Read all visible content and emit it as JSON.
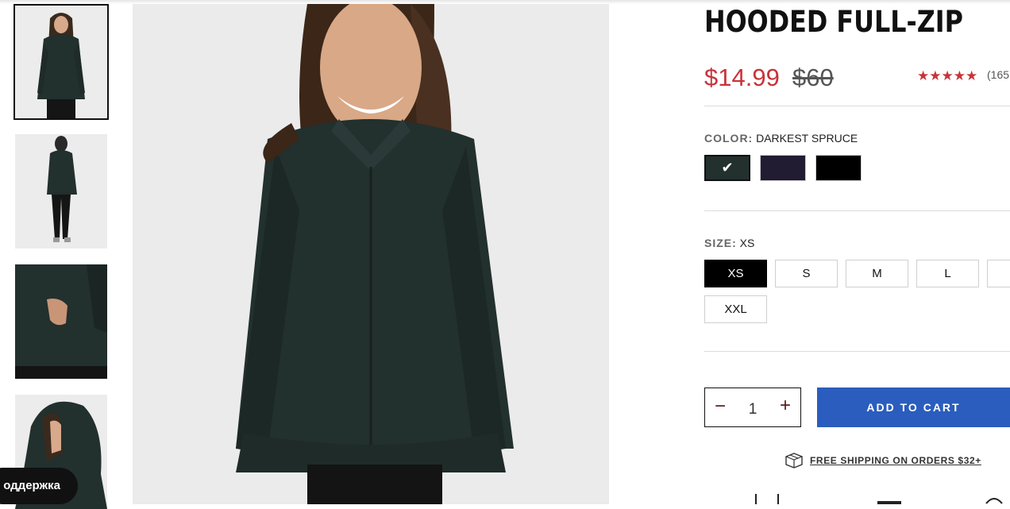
{
  "product": {
    "title": "HOODED FULL-ZIP",
    "price": "$14.99",
    "old_price": "$60",
    "rating_stars": "★★★★★",
    "rating_value": 5,
    "reviews": "(165"
  },
  "color": {
    "label": "COLOR:",
    "selected": "DARKEST SPRUCE",
    "swatches": [
      {
        "name": "darkest-spruce",
        "hex": "#22302e",
        "selected": true
      },
      {
        "name": "dark-navy",
        "hex": "#221c33",
        "selected": false
      },
      {
        "name": "black",
        "hex": "#000000",
        "selected": false
      }
    ],
    "check_icon": "✔"
  },
  "size": {
    "label": "SIZE:",
    "selected": "XS",
    "options": [
      "XS",
      "S",
      "M",
      "L",
      "XXL"
    ]
  },
  "quantity": {
    "minus": "−",
    "value": "1",
    "plus": "+"
  },
  "cart": {
    "button_label": "ADD TO CART"
  },
  "shipping": {
    "text": "FREE SHIPPING ON ORDERS $32+",
    "icon": "package-icon"
  },
  "support": {
    "label": "оддержка"
  },
  "colors": {
    "accent_red": "#c8333a",
    "cart_blue": "#2a5dbd",
    "jacket": "#22302e"
  }
}
